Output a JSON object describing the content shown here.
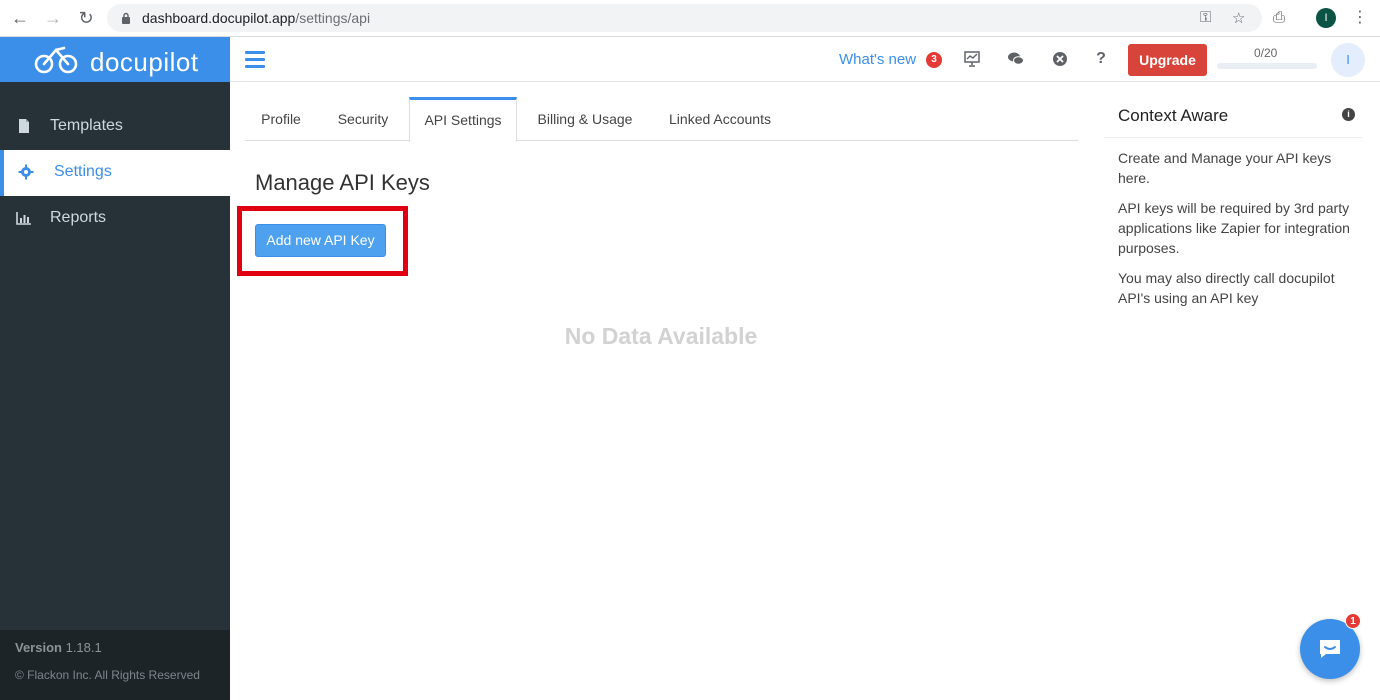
{
  "browser": {
    "url_domain": "dashboard.docupilot.app",
    "url_path": "/settings/api",
    "profile_initial": "I"
  },
  "sidebar": {
    "brand": "docupilot",
    "items": [
      {
        "label": "Templates",
        "icon": "file-icon",
        "active": false
      },
      {
        "label": "Settings",
        "icon": "gear-icon",
        "active": true
      },
      {
        "label": "Reports",
        "icon": "bar-chart-icon",
        "active": false
      }
    ],
    "version_label": "Version",
    "version_number": "1.18.1",
    "copyright": "© Flackon Inc. All Rights Reserved"
  },
  "header": {
    "whats_new": "What's new",
    "whats_new_count": "3",
    "upgrade": "Upgrade",
    "quota": "0/20",
    "user_initial": "I"
  },
  "tabs": [
    {
      "label": "Profile"
    },
    {
      "label": "Security"
    },
    {
      "label": "API Settings"
    },
    {
      "label": "Billing & Usage"
    },
    {
      "label": "Linked Accounts"
    }
  ],
  "main": {
    "title": "Manage API Keys",
    "add_button": "Add new API Key",
    "empty": "No Data Available"
  },
  "context": {
    "title": "Context Aware",
    "p1": "Create and Manage your API keys here.",
    "p2": "API keys will be required by 3rd party applications like Zapier for integration purposes.",
    "p3": "You may also directly call docupilot API's using an API key"
  },
  "chat": {
    "badge": "1"
  },
  "colors": {
    "accent": "#3b8fe8",
    "sidebar": "#263238",
    "upgrade": "#d9443a",
    "highlight": "#e00012"
  }
}
